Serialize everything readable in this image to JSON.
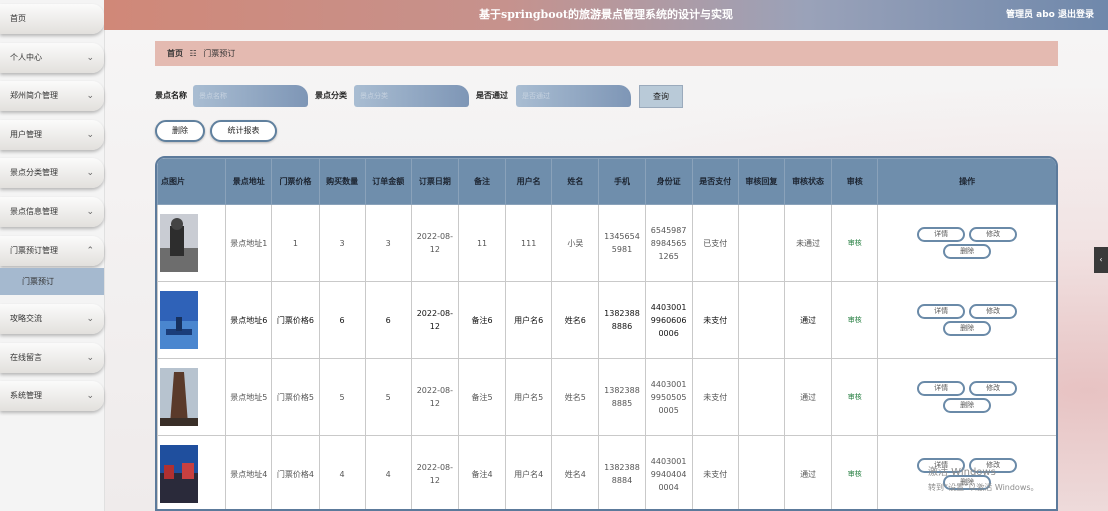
{
  "header": {
    "title": "基于springboot的旅游景点管理系统的设计与实现",
    "user": "管理员 abo  退出登录"
  },
  "sidebar": {
    "items": [
      {
        "label": "首页",
        "chev": ""
      },
      {
        "label": "个人中心",
        "chev": "⌄"
      },
      {
        "label": "郑州简介管理",
        "chev": "⌄"
      },
      {
        "label": "用户管理",
        "chev": "⌄"
      },
      {
        "label": "景点分类管理",
        "chev": "⌄"
      },
      {
        "label": "景点信息管理",
        "chev": "⌄"
      },
      {
        "label": "门票预订管理",
        "chev": "⌃"
      },
      {
        "label": "攻略交流",
        "chev": "⌄"
      },
      {
        "label": "在线留言",
        "chev": "⌄"
      },
      {
        "label": "系统管理",
        "chev": "⌄"
      }
    ],
    "sub_active": "门票预订"
  },
  "breadcrumb": {
    "home": "首页",
    "sep": "☷",
    "current": "门票预订"
  },
  "search": {
    "name_label": "景点名称",
    "name_placeholder": "景点名称",
    "cat_label": "景点分类",
    "cat_placeholder": "景点分类",
    "pass_label": "是否通过",
    "pass_placeholder": "是否通过",
    "button": "查询"
  },
  "actions": {
    "delete": "删除",
    "report": "统计报表"
  },
  "table": {
    "headers": [
      "点图片",
      "景点地址",
      "门票价格",
      "购买数量",
      "订单金额",
      "订票日期",
      "备注",
      "用户名",
      "姓名",
      "手机",
      "身份证",
      "是否支付",
      "审核回复",
      "审核状态",
      "审核",
      "操作"
    ],
    "rows": [
      {
        "address": "景点地址1",
        "price": "1",
        "qty": "3",
        "amount": "3",
        "date": "2022-08-12",
        "note": "11",
        "user": "111",
        "name": "小吴",
        "phone": "13456545981",
        "id": "654598789845651265",
        "paid": "已支付",
        "reply": "",
        "status": "未通过",
        "audit": "审核"
      },
      {
        "address": "景点地址6",
        "price": "门票价格6",
        "qty": "6",
        "amount": "6",
        "date": "2022-08-12",
        "note": "备注6",
        "user": "用户名6",
        "name": "姓名6",
        "phone": "13823888886",
        "id": "440300199606060006",
        "paid": "未支付",
        "reply": "",
        "status": "通过",
        "audit": "审核"
      },
      {
        "address": "景点地址5",
        "price": "门票价格5",
        "qty": "5",
        "amount": "5",
        "date": "2022-08-12",
        "note": "备注5",
        "user": "用户名5",
        "name": "姓名5",
        "phone": "13823888885",
        "id": "440300199505050005",
        "paid": "未支付",
        "reply": "",
        "status": "通过",
        "audit": "审核"
      },
      {
        "address": "景点地址4",
        "price": "门票价格4",
        "qty": "4",
        "amount": "4",
        "date": "2022-08-12",
        "note": "备注4",
        "user": "用户名4",
        "name": "姓名4",
        "phone": "13823888884",
        "id": "440300199404040004",
        "paid": "未支付",
        "reply": "",
        "status": "通过",
        "audit": "审核"
      }
    ],
    "ops": {
      "detail": "详情",
      "edit": "修改",
      "delete": "删除"
    }
  },
  "watermark": {
    "line1": "激活 Windows",
    "line2": "转到“设置”以激活 Windows。"
  },
  "edge_toggle": "‹"
}
